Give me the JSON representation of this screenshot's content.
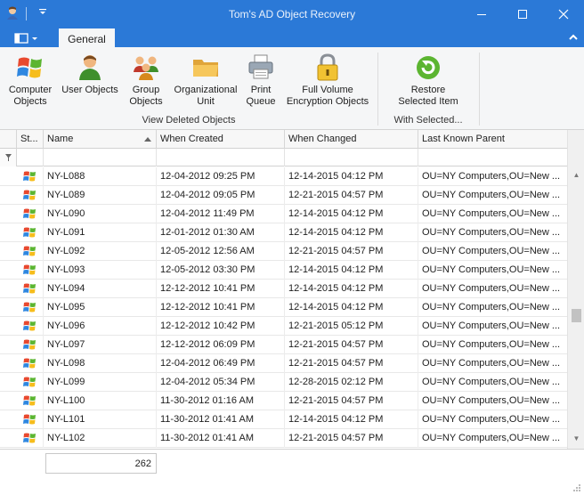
{
  "window": {
    "title": "Tom's AD Object Recovery"
  },
  "ribbon": {
    "tab_general": "General",
    "buttons": {
      "computer_objects": [
        "Computer",
        "Objects"
      ],
      "user_objects": [
        "User Objects"
      ],
      "group_objects": [
        "Group",
        "Objects"
      ],
      "organizational_unit": [
        "Organizational",
        "Unit"
      ],
      "print_queue": [
        "Print",
        "Queue"
      ],
      "full_volume": [
        "Full Volume",
        "Encryption Objects"
      ],
      "restore": [
        "Restore",
        "Selected Item"
      ]
    },
    "groups": {
      "view_deleted": "View Deleted Objects",
      "with_selected": "With Selected..."
    }
  },
  "grid": {
    "columns": {
      "status": "St...",
      "name": "Name",
      "when_created": "When Created",
      "when_changed": "When Changed",
      "last_known_parent": "Last Known Parent"
    },
    "rows": [
      {
        "name": "NY-L088",
        "created": "12-04-2012 09:25 PM",
        "changed": "12-14-2015 04:12 PM",
        "parent": "OU=NY Computers,OU=New ..."
      },
      {
        "name": "NY-L089",
        "created": "12-04-2012 09:05 PM",
        "changed": "12-21-2015 04:57 PM",
        "parent": "OU=NY Computers,OU=New ..."
      },
      {
        "name": "NY-L090",
        "created": "12-04-2012 11:49 PM",
        "changed": "12-14-2015 04:12 PM",
        "parent": "OU=NY Computers,OU=New ..."
      },
      {
        "name": "NY-L091",
        "created": "12-01-2012 01:30 AM",
        "changed": "12-14-2015 04:12 PM",
        "parent": "OU=NY Computers,OU=New ..."
      },
      {
        "name": "NY-L092",
        "created": "12-05-2012 12:56 AM",
        "changed": "12-21-2015 04:57 PM",
        "parent": "OU=NY Computers,OU=New ..."
      },
      {
        "name": "NY-L093",
        "created": "12-05-2012 03:30 PM",
        "changed": "12-14-2015 04:12 PM",
        "parent": "OU=NY Computers,OU=New ..."
      },
      {
        "name": "NY-L094",
        "created": "12-12-2012 10:41 PM",
        "changed": "12-14-2015 04:12 PM",
        "parent": "OU=NY Computers,OU=New ..."
      },
      {
        "name": "NY-L095",
        "created": "12-12-2012 10:41 PM",
        "changed": "12-14-2015 04:12 PM",
        "parent": "OU=NY Computers,OU=New ..."
      },
      {
        "name": "NY-L096",
        "created": "12-12-2012 10:42 PM",
        "changed": "12-21-2015 05:12 PM",
        "parent": "OU=NY Computers,OU=New ..."
      },
      {
        "name": "NY-L097",
        "created": "12-12-2012 06:09 PM",
        "changed": "12-21-2015 04:57 PM",
        "parent": "OU=NY Computers,OU=New ..."
      },
      {
        "name": "NY-L098",
        "created": "12-04-2012 06:49 PM",
        "changed": "12-21-2015 04:57 PM",
        "parent": "OU=NY Computers,OU=New ..."
      },
      {
        "name": "NY-L099",
        "created": "12-04-2012 05:34 PM",
        "changed": "12-28-2015 02:12 PM",
        "parent": "OU=NY Computers,OU=New ..."
      },
      {
        "name": "NY-L100",
        "created": "11-30-2012 01:16 AM",
        "changed": "12-21-2015 04:57 PM",
        "parent": "OU=NY Computers,OU=New ..."
      },
      {
        "name": "NY-L101",
        "created": "11-30-2012 01:41 AM",
        "changed": "12-14-2015 04:12 PM",
        "parent": "OU=NY Computers,OU=New ..."
      },
      {
        "name": "NY-L102",
        "created": "11-30-2012 01:41 AM",
        "changed": "12-21-2015 04:57 PM",
        "parent": "OU=NY Computers,OU=New ..."
      }
    ]
  },
  "footer": {
    "count": "262"
  },
  "colors": {
    "title_bar": "#2b79d7",
    "ribbon_bg": "#f5f6f7"
  }
}
